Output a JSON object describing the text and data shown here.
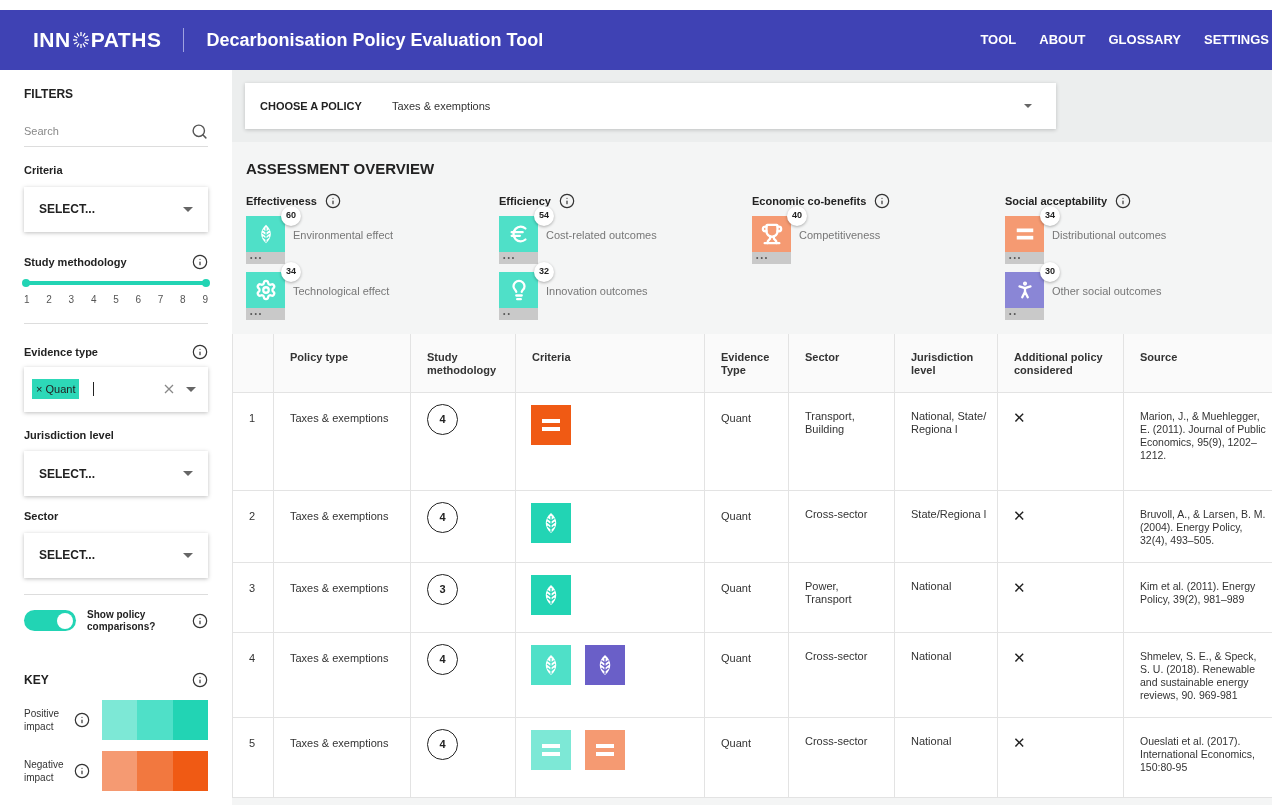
{
  "header": {
    "logo_before": "INN",
    "logo_after": "PATHS",
    "title": "Decarbonisation Policy Evaluation Tool",
    "nav": [
      "TOOL",
      "ABOUT",
      "GLOSSARY",
      "SETTINGS"
    ]
  },
  "sidebar": {
    "title": "FILTERS",
    "search": {
      "placeholder": "Search"
    },
    "criteria": {
      "label": "Criteria",
      "value": "SELECT..."
    },
    "study_methodology": {
      "label": "Study methodology",
      "ticks": [
        "1",
        "2",
        "3",
        "4",
        "5",
        "6",
        "7",
        "8",
        "9"
      ],
      "level": 1
    },
    "evidence_type": {
      "label": "Evidence type",
      "tags": [
        "Quant"
      ],
      "tag_remove": "×"
    },
    "jurisdiction_level": {
      "label": "Jurisdiction level",
      "value": "SELECT..."
    },
    "sector": {
      "label": "Sector",
      "value": "SELECT..."
    },
    "toggle": {
      "label": "Show policy comparisons?",
      "on": true
    },
    "key": {
      "title": "KEY",
      "rows": [
        {
          "label": "Positive impact",
          "swatches": [
            {
              "color": "#7de8d6"
            },
            {
              "color": "#4fe0c8"
            },
            {
              "color": "#22d4b4"
            }
          ]
        },
        {
          "label": "Negative impact",
          "swatches": [
            {
              "color": "#f59a72"
            },
            {
              "color": "#f2783f"
            },
            {
              "color": "#f05a14"
            }
          ]
        }
      ]
    }
  },
  "policy": {
    "label": "CHOOSE A POLICY",
    "value": "Taxes & exemptions"
  },
  "overview": {
    "title": "ASSESSMENT OVERVIEW",
    "groups": [
      {
        "title": "Effectiveness",
        "items": [
          {
            "kind": "leaf",
            "color": "#4fe0c8",
            "count": "60",
            "label": "Environmental effect",
            "dots": "• • •"
          },
          {
            "kind": "gear",
            "color": "#4fe0c8",
            "count": "34",
            "label": "Technological effect",
            "dots": "• • •"
          }
        ]
      },
      {
        "title": "Efficiency",
        "items": [
          {
            "kind": "euro",
            "color": "#4fe0c8",
            "count": "54",
            "label": "Cost-related outcomes",
            "dots": "• • •"
          },
          {
            "kind": "bulb",
            "color": "#4fe0c8",
            "count": "32",
            "label": "Innovation outcomes",
            "dots": "• •"
          }
        ]
      },
      {
        "title": "Economic co-benefits",
        "items": [
          {
            "kind": "trophy",
            "color": "#f59a72",
            "count": "40",
            "label": "Competitiveness",
            "dots": "• • •"
          }
        ]
      },
      {
        "title": "Social acceptability",
        "items": [
          {
            "kind": "equals",
            "color": "#f59a72",
            "count": "34",
            "label": "Distributional outcomes",
            "dots": "• • •"
          },
          {
            "kind": "person",
            "color": "#8a86d6",
            "count": "30",
            "label": "Other social outcomes",
            "dots": "• •"
          }
        ]
      }
    ]
  },
  "table": {
    "columns": [
      "",
      "Policy type",
      "Study methodology",
      "Criteria",
      "Evidence Type",
      "Sector",
      "Jurisdiction level",
      "Additional policy considered",
      "Source"
    ],
    "rows": [
      {
        "number": "1",
        "policy_type": "Taxes & exemptions",
        "methodology": "4",
        "criteria": [
          {
            "kind": "equals",
            "color": "#f05a14"
          }
        ],
        "evidence": "Quant",
        "sector": "Transport, Building",
        "jurisdiction": "National, State/Regiona l",
        "additional": "✕",
        "source": "Marion, J., & Muehlegger, E. (2011). Journal of Public Economics, 95(9), 1202–1212."
      },
      {
        "number": "2",
        "policy_type": "Taxes & exemptions",
        "methodology": "4",
        "criteria": [
          {
            "kind": "leaf",
            "color": "#22d4b4"
          }
        ],
        "evidence": "Quant",
        "sector": "Cross-sector",
        "jurisdiction": "State/Regiona l",
        "additional": "✕",
        "source": "Bruvoll, A., & Larsen, B. M. (2004). Energy Policy, 32(4), 493–505."
      },
      {
        "number": "3",
        "policy_type": "Taxes & exemptions",
        "methodology": "3",
        "criteria": [
          {
            "kind": "leaf",
            "color": "#22d4b4"
          }
        ],
        "evidence": "Quant",
        "sector": "Power, Transport",
        "jurisdiction": "National",
        "additional": "✕",
        "source": "Kim et al. (2011). Energy Policy, 39(2), 981–989"
      },
      {
        "number": "4",
        "policy_type": "Taxes & exemptions",
        "methodology": "4",
        "criteria": [
          {
            "kind": "leaf",
            "color": "#4fe0c8"
          },
          {
            "kind": "leaf",
            "color": "#6a5fc8"
          }
        ],
        "evidence": "Quant",
        "sector": "Cross-sector",
        "jurisdiction": "National",
        "additional": "✕",
        "source": "Shmelev, S. E., & Speck, S. U. (2018). Renewable and sustainable energy reviews, 90. 969-981"
      },
      {
        "number": "5",
        "policy_type": "Taxes & exemptions",
        "methodology": "4",
        "criteria": [
          {
            "kind": "equals",
            "color": "#7de8d6"
          },
          {
            "kind": "equals",
            "color": "#f59a72"
          }
        ],
        "evidence": "Quant",
        "sector": "Cross-sector",
        "jurisdiction": "National",
        "additional": "✕",
        "source": "Oueslati et al. (2017). International Economics, 150:80-95"
      }
    ]
  }
}
